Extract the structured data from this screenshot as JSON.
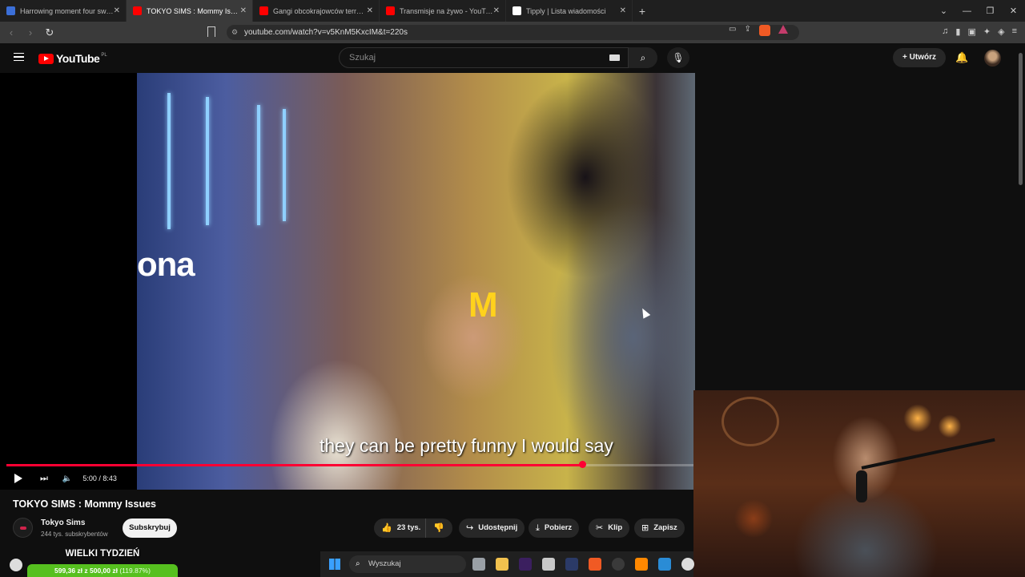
{
  "browser": {
    "tabs": [
      {
        "title": "Harrowing moment four sword-wie",
        "favicon_color": "#3b6fd8",
        "active": false
      },
      {
        "title": "TOKYO SIMS : Mommy Issues",
        "favicon_color": "#ff0000",
        "active": true
      },
      {
        "title": "Gangi obcokrajowców terroryzują P",
        "favicon_color": "#ff0000",
        "active": false
      },
      {
        "title": "Transmisje na żywo - YouTube Studi",
        "favicon_color": "#ff0000",
        "active": false
      },
      {
        "title": "Tipply | Lista wiadomości",
        "favicon_color": "#ffffff",
        "active": false
      }
    ],
    "url": "youtube.com/watch?v=v5KnM5KxcIM&t=220s"
  },
  "masthead": {
    "logo_text": "YouTube",
    "region": "PL",
    "search_placeholder": "Szukaj",
    "create_label": "Utwórz"
  },
  "player": {
    "subtitle": "they can be pretty funny I would say",
    "time": "5:00 / 8:43",
    "progress": 0.836
  },
  "video": {
    "title": "TOKYO SIMS : Mommy Issues",
    "channel": "Tokyo Sims",
    "subscribers": "244 tys. subskrybentów",
    "subscribe_label": "Subskrybuj",
    "likes": "23 tys.",
    "share_label": "Udostępnij",
    "download_label": "Pobierz",
    "clip_label": "Klip",
    "save_label": "Zapisz"
  },
  "overlay": {
    "donation_title": "WIELKI TYDZIEŃ",
    "donation_amount": "599,36 zł z 500,00 zł",
    "donation_percent": "(119.87%)",
    "taskbar_search": "Wyszukaj"
  },
  "colors": {
    "accent": "#ff0033",
    "donation_green": "#56c01f"
  }
}
